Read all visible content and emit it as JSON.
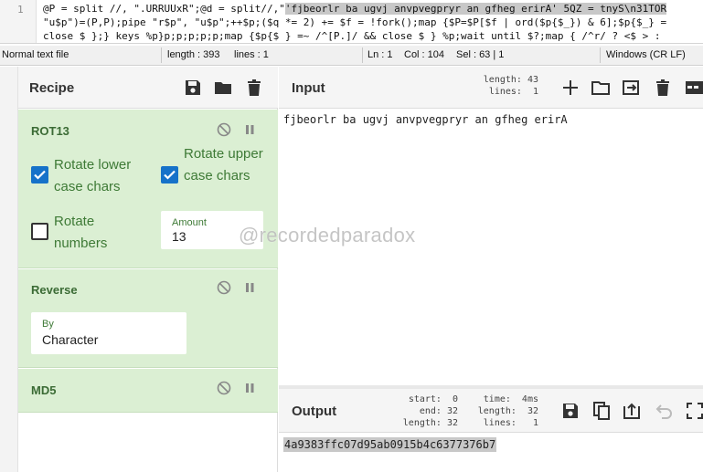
{
  "editor": {
    "line_number": "1",
    "line1_prefix": "@P = split //, \".URRUUxR\";@d = split//,\"",
    "line1_selected": "'fjbeorlr ba ugvj anvpvegpryr an gfheg erirA' 5QZ = tnyS\\n31TOR",
    "line2": "\"u$p\")=(P,P);pipe \"r$p\", \"u$p\";++$p;($q *= 2) += $f = !fork();map {$P=$P[$f | ord($p{$_}) & 6];$p{$_} =",
    "line3": "close $ };} keys %p}p;p;p;p;p;map {$p{$ } =~ /^[P.]/ && close $ } %p;wait until $?;map { /^r/ ? <$ > :"
  },
  "statusbar": {
    "file_type": "Normal text file",
    "length": "length : 393",
    "lines": "lines : 1",
    "ln": "Ln : 1",
    "col": "Col : 104",
    "sel": "Sel : 63 | 1",
    "eol": "Windows (CR LF)"
  },
  "recipe": {
    "title": "Recipe",
    "operations": [
      {
        "name": "ROT13",
        "options": {
          "rotate_lower": {
            "label": "Rotate lower case chars",
            "checked": true
          },
          "rotate_upper": {
            "label": "Rotate upper case chars",
            "checked": true
          },
          "rotate_numbers": {
            "label": "Rotate numbers",
            "checked": false
          },
          "amount": {
            "label": "Amount",
            "value": "13"
          }
        }
      },
      {
        "name": "Reverse",
        "options": {
          "by": {
            "label": "By",
            "value": "Character"
          }
        }
      },
      {
        "name": "MD5"
      }
    ]
  },
  "input": {
    "title": "Input",
    "stats": {
      "length": "length: 43",
      "lines": "lines:  1"
    },
    "text": "fjbeorlr ba ugvj anvpvegpryr an gfheg erirA"
  },
  "output": {
    "title": "Output",
    "stats": {
      "start": "start:  0",
      "end": "end: 32",
      "length": "length: 32",
      "time": "time:  4ms",
      "length2": "length:  32",
      "lines": "lines:   1"
    },
    "text": "4a9383ffc07d95ab0915b4c6377376b7"
  },
  "watermark": "@recordedparadox",
  "colors": {
    "accent_blue": "#1672c9",
    "op_bg": "#dbefd3",
    "op_text": "#3e7a36"
  }
}
